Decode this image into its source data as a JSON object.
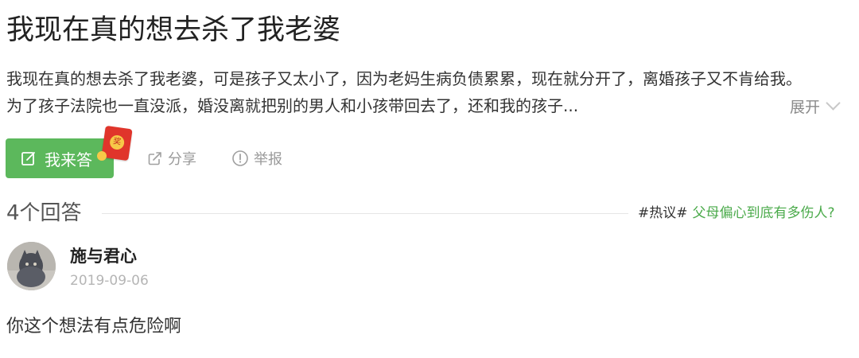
{
  "question": {
    "title": "我现在真的想去杀了我老婆",
    "description_lines": [
      "我现在真的想去杀了我老婆，可是孩子又太小了，因为老妈生病负债累累，现在就分开了，离婚孩子又不肯给我。",
      "为了孩子法院也一直没派，婚没离就把别的男人和小孩带回去了，还和我的孩子..."
    ],
    "expand_label": "展开"
  },
  "actions": {
    "answer_label": "我来答",
    "redpacket_char": "奖",
    "share_label": "分享",
    "report_label": "举报"
  },
  "answers_header": {
    "count_label": "4个回答",
    "hot_tag": "#热议#",
    "hot_topic": "父母偏心到底有多伤人?"
  },
  "answer": {
    "user_name": "施与君心",
    "date": "2019-09-06",
    "text": "你这个想法有点危险啊"
  },
  "colors": {
    "accent_green": "#5cb85c",
    "topic_green": "#4aaa4a",
    "redpacket_red": "#e0352b"
  },
  "icons": {
    "answer": "edit-icon",
    "share": "share-icon",
    "report": "report-icon",
    "expand": "chevron-down-icon"
  }
}
